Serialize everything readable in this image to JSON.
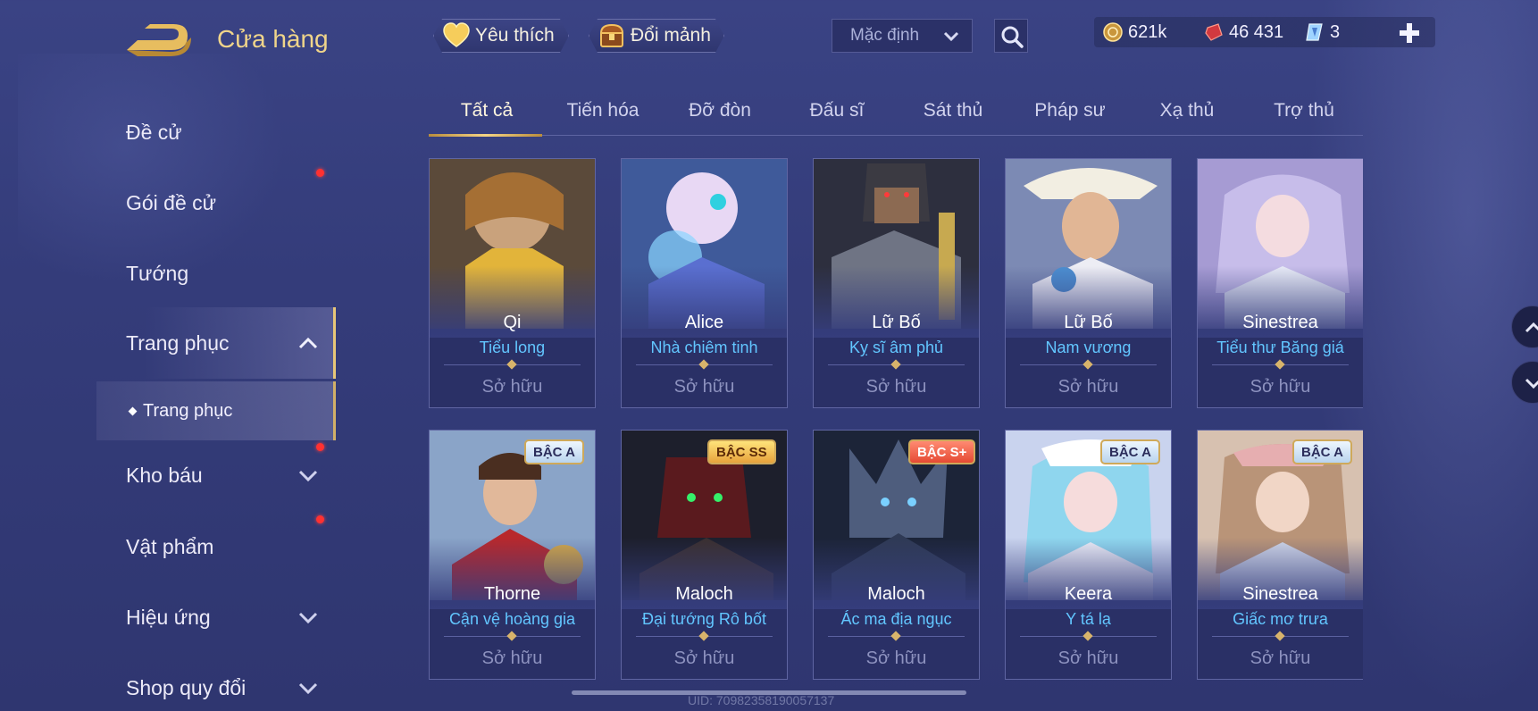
{
  "header": {
    "title": "Cửa hàng",
    "favorites_label": "Yêu thích",
    "exchange_label": "Đổi mảnh",
    "sort_value": "Mặc định",
    "currencies": {
      "gold": "621k",
      "ruby": "46 431",
      "gem": "3"
    }
  },
  "sidebar": {
    "items": [
      {
        "label": "Đề cử"
      },
      {
        "label": "Gói đề cử"
      },
      {
        "label": "Tướng"
      },
      {
        "label": "Trang phục"
      },
      {
        "label": "Kho báu"
      },
      {
        "label": "Vật phẩm"
      },
      {
        "label": "Hiệu ứng"
      },
      {
        "label": "Shop quy đổi"
      }
    ],
    "sub_item": "Trang phục"
  },
  "tabs": [
    "Tất cả",
    "Tiến hóa",
    "Đỡ đòn",
    "Đấu sĩ",
    "Sát thủ",
    "Pháp sư",
    "Xạ thủ",
    "Trợ thủ"
  ],
  "cards": [
    {
      "hero": "Qi",
      "skin": "Tiểu long",
      "status": "Sở hữu",
      "tier": ""
    },
    {
      "hero": "Alice",
      "skin": "Nhà chiêm tinh",
      "status": "Sở hữu",
      "tier": ""
    },
    {
      "hero": "Lữ Bố",
      "skin": "Kỵ sĩ âm phủ",
      "status": "Sở hữu",
      "tier": ""
    },
    {
      "hero": "Lữ Bố",
      "skin": "Nam vương",
      "status": "Sở hữu",
      "tier": ""
    },
    {
      "hero": "Sinestrea",
      "skin": "Tiểu thư Băng giá",
      "status": "Sở hữu",
      "tier": ""
    },
    {
      "hero": "Thorne",
      "skin": "Cận vệ hoàng gia",
      "status": "Sở hữu",
      "tier": "BẬC A"
    },
    {
      "hero": "Maloch",
      "skin": "Đại tướng Rô bốt",
      "status": "Sở hữu",
      "tier": "BẬC SS"
    },
    {
      "hero": "Maloch",
      "skin": "Ác ma địa ngục",
      "status": "Sở hữu",
      "tier": "BẬC S+"
    },
    {
      "hero": "Keera",
      "skin": "Y tá lạ",
      "status": "Sở hữu",
      "tier": "BẬC A"
    },
    {
      "hero": "Sinestrea",
      "skin": "Giấc mơ trưa",
      "status": "Sở hữu",
      "tier": "BẬC A"
    }
  ],
  "footer": {
    "uid": "UID: 70982358190057137"
  },
  "colors": {
    "accent_gold": "#f0d58a",
    "skin_name_blue": "#62c6ff",
    "notification_red": "#ff3131"
  }
}
